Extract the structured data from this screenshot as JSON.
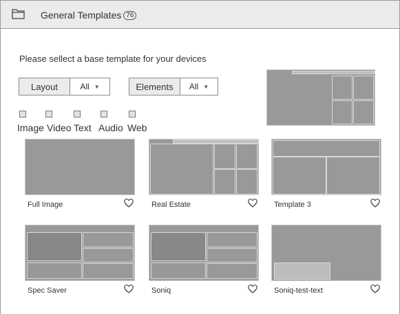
{
  "header": {
    "title": "General Templates",
    "count": "76"
  },
  "instruction": "Please sellect a base template for your devices",
  "filters": [
    {
      "label": "Layout",
      "value": "All"
    },
    {
      "label": "Elements",
      "value": "All"
    }
  ],
  "element_types": [
    "Image",
    "Video",
    "Text",
    "Audio",
    "Web"
  ],
  "templates": [
    {
      "name": "Full Image"
    },
    {
      "name": "Real Estate"
    },
    {
      "name": "Template 3"
    },
    {
      "name": "Spec Saver"
    },
    {
      "name": "Soniq"
    },
    {
      "name": "Soniq-test-text"
    }
  ],
  "icons": {
    "header": "folder-icon",
    "favorite": "heart-icon",
    "dropdown": "chevron-down-icon"
  },
  "colors": {
    "header_bg": "#ebebeb",
    "thumbnail": "#999999",
    "border": "#9a9a9a"
  }
}
